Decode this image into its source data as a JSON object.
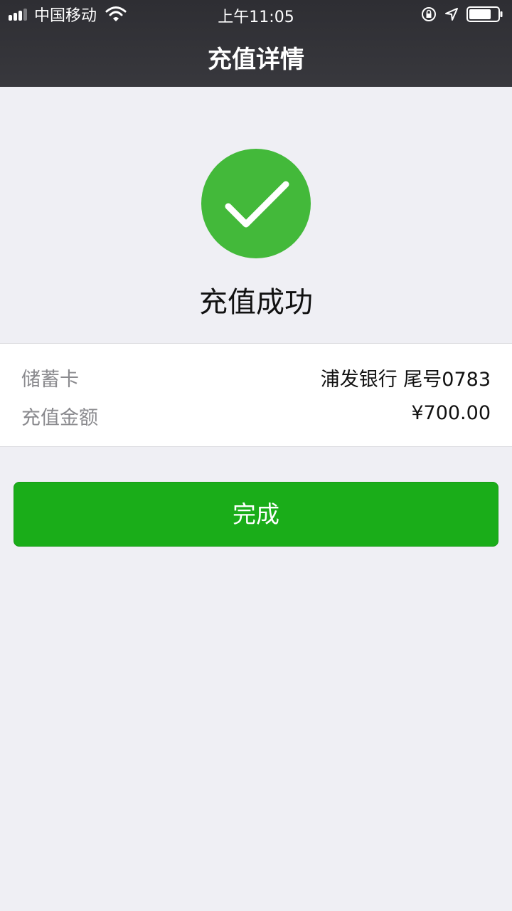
{
  "status_bar": {
    "carrier": "中国移动",
    "time": "上午11:05"
  },
  "nav": {
    "title": "充值详情"
  },
  "result": {
    "icon": "check-circle-icon",
    "text": "充值成功",
    "color": "#43b93a"
  },
  "details": {
    "card_label": "储蓄卡",
    "card_value": "浦发银行 尾号0783",
    "amount_label": "充值金额",
    "amount_value": "¥700.00"
  },
  "actions": {
    "done_label": "完成",
    "accent_color": "#1aad19"
  }
}
